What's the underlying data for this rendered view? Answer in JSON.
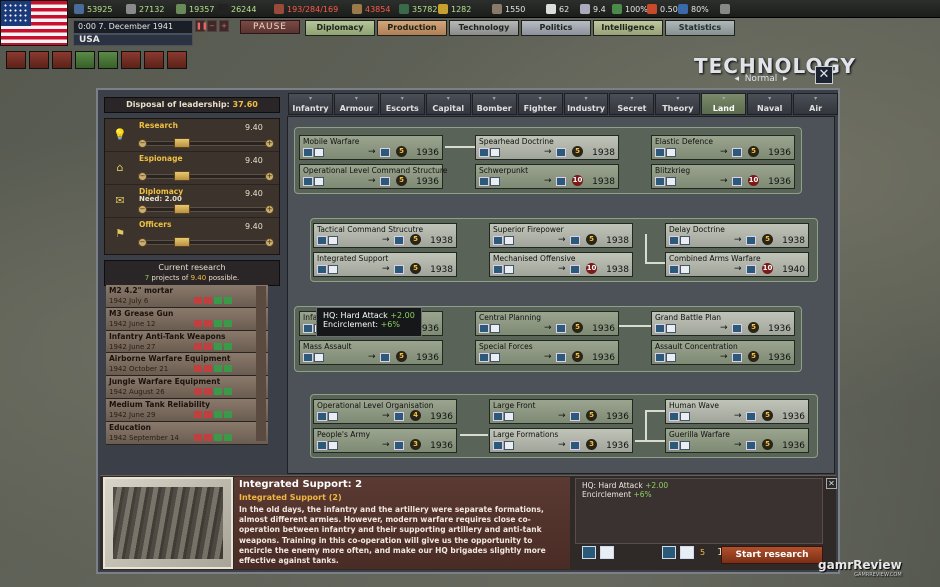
{
  "topbar": {
    "resources": [
      {
        "value": "53925",
        "color": "#b8e090"
      },
      {
        "value": "27132",
        "color": "#b8e090"
      },
      {
        "value": "19357",
        "color": "#b8e090"
      },
      {
        "value": "26244",
        "color": "#b8e090"
      },
      {
        "value": "193/284/169",
        "color": "#ff5a4a"
      },
      {
        "value": "43854",
        "color": "#ff5a4a"
      },
      {
        "value": "35782",
        "color": "#b8e090"
      },
      {
        "value": "1282",
        "color": "#b8e090"
      },
      {
        "value": "1550",
        "color": "#e6e6e6"
      },
      {
        "value": "62",
        "color": "#e6e6e6"
      },
      {
        "value": "9.4",
        "color": "#e6e6e6"
      },
      {
        "value": "100%",
        "color": "#e6e6e6"
      },
      {
        "value": "0.50",
        "color": "#e6e6e6"
      },
      {
        "value": "80%",
        "color": "#e6e6e6"
      }
    ],
    "date": "0:00 7. December 1941",
    "country": "USA",
    "pause_label": "PAUSE",
    "menu": [
      "Diplomacy",
      "Production",
      "Technology",
      "Politics",
      "Intelligence",
      "Statistics"
    ]
  },
  "header": {
    "title": "TECHNOLOGY",
    "difficulty": "Normal",
    "close": "✕"
  },
  "leadership": {
    "label": "Disposal of leadership:",
    "amount": "37.60",
    "sliders": [
      {
        "name": "Research",
        "need": "",
        "value": "9.40",
        "icon": "bulb-icon",
        "glyph": "💡"
      },
      {
        "name": "Espionage",
        "need": "",
        "value": "9.40",
        "icon": "spy-icon",
        "glyph": "⌂"
      },
      {
        "name": "Diplomacy",
        "need": "Need: 2.00",
        "value": "9.40",
        "icon": "envelope-icon",
        "glyph": "✉"
      },
      {
        "name": "Officers",
        "need": "",
        "value": "9.40",
        "icon": "flag-icon",
        "glyph": "⚑"
      }
    ],
    "slider_fraction": 0.25
  },
  "current_research": {
    "title": "Current research",
    "count": "7",
    "projects_text": "projects of",
    "max": "9.40",
    "possible_text": "possible.",
    "items": [
      {
        "name": "M2 4.2\" mortar",
        "date": "1942 July 6"
      },
      {
        "name": "M3 Grease Gun",
        "date": "1942 June 12"
      },
      {
        "name": "Infantry Anti-Tank Weapons",
        "date": "1942 June 27"
      },
      {
        "name": "Airborne Warfare Equipment",
        "date": "1942 October 21"
      },
      {
        "name": "Jungle Warfare Equipment",
        "date": "1942 August 26"
      },
      {
        "name": "Medium Tank Reliability",
        "date": "1942 June 29"
      },
      {
        "name": "Education",
        "date": "1942 September 14"
      }
    ]
  },
  "tabs": [
    {
      "label": "Infantry",
      "active": false
    },
    {
      "label": "Armour",
      "active": false
    },
    {
      "label": "Escorts",
      "active": false
    },
    {
      "label": "Capital",
      "active": false
    },
    {
      "label": "Bomber",
      "active": false
    },
    {
      "label": "Fighter",
      "active": false
    },
    {
      "label": "Industry",
      "active": false
    },
    {
      "label": "Secret",
      "active": false
    },
    {
      "label": "Theory",
      "active": false
    },
    {
      "label": "Land",
      "active": true
    },
    {
      "label": "Naval",
      "active": false
    },
    {
      "label": "Air",
      "active": false
    }
  ],
  "techs": {
    "g1": [
      {
        "name": "Mobile Warfare",
        "level": "5",
        "year": "1936",
        "lit": false,
        "red": false
      },
      {
        "name": "Spearhead Doctrine",
        "level": "5",
        "year": "1938",
        "lit": true,
        "red": false
      },
      {
        "name": "Elastic Defence",
        "level": "5",
        "year": "1936",
        "lit": false,
        "red": false
      },
      {
        "name": "Operational Level Command Structure",
        "level": "5",
        "year": "1936",
        "lit": false,
        "red": false
      },
      {
        "name": "Schwerpunkt",
        "level": "10",
        "year": "1938",
        "lit": false,
        "red": true
      },
      {
        "name": "Blitzkrieg",
        "level": "10",
        "year": "1936",
        "lit": false,
        "red": true
      }
    ],
    "g2": [
      {
        "name": "Tactical Command Strucutre",
        "level": "5",
        "year": "1938",
        "lit": true,
        "red": false
      },
      {
        "name": "Superior Firepower",
        "level": "5",
        "year": "1938",
        "lit": true,
        "red": false
      },
      {
        "name": "Delay Doctrine",
        "level": "5",
        "year": "1938",
        "lit": true,
        "red": false
      },
      {
        "name": "Integrated Support",
        "level": "5",
        "year": "1938",
        "lit": true,
        "red": false
      },
      {
        "name": "Mechanised Offensive",
        "level": "10",
        "year": "1938",
        "lit": true,
        "red": true
      },
      {
        "name": "Combined Arms Warfare",
        "level": "10",
        "year": "1940",
        "lit": true,
        "red": true
      }
    ],
    "g3": [
      {
        "name": "Infantry Warfare",
        "level": "5",
        "year": "1936",
        "lit": false,
        "red": false
      },
      {
        "name": "Central Planning",
        "level": "5",
        "year": "1936",
        "lit": false,
        "red": false
      },
      {
        "name": "Grand Battle Plan",
        "level": "5",
        "year": "1936",
        "lit": true,
        "red": false
      },
      {
        "name": "Mass Assault",
        "level": "5",
        "year": "1936",
        "lit": false,
        "red": false
      },
      {
        "name": "Special Forces",
        "level": "5",
        "year": "1936",
        "lit": false,
        "red": false
      },
      {
        "name": "Assault Concentration",
        "level": "5",
        "year": "1936",
        "lit": false,
        "red": false
      }
    ],
    "g4": [
      {
        "name": "Operational Level Organisation",
        "level": "4",
        "year": "1936",
        "lit": false,
        "red": false
      },
      {
        "name": "Large Front",
        "level": "5",
        "year": "1936",
        "lit": false,
        "red": false
      },
      {
        "name": "Human Wave",
        "level": "5",
        "year": "1936",
        "lit": true,
        "red": false
      },
      {
        "name": "People's Army",
        "level": "3",
        "year": "1936",
        "lit": false,
        "red": false
      },
      {
        "name": "Large Formations",
        "level": "3",
        "year": "1936",
        "lit": true,
        "red": false
      },
      {
        "name": "Guerilla Warfare",
        "level": "5",
        "year": "1936",
        "lit": false,
        "red": false
      }
    ]
  },
  "tooltip": {
    "line1_label": "HQ: Hard Attack",
    "line1_value": "+2.00",
    "line2_label": "Encirclement:",
    "line2_value": "+6%"
  },
  "detail": {
    "title": "Integrated Support: 2",
    "subtitle": "Integrated Support (2)",
    "text": "In the old days, the infantry and the artillery were separate formations, almost different armies. However, modern warfare requires close co-operation between infantry and their supporting artillery and anti-tank weapons. Training in this co-operation will give us the opportunity to encircle the enemy more often, and make our HQ brigades slightly more effective against tanks.",
    "effect1_label": "HQ: Hard Attack",
    "effect1_value": "+2.00",
    "effect2_label": "Encirclement",
    "effect2_value": "+6%",
    "cost": "5",
    "year": "1938",
    "start_label": "Start research",
    "close": "✕"
  },
  "watermark": {
    "name": "gamrReview",
    "tag": "GAMRREVIEW.COM"
  }
}
